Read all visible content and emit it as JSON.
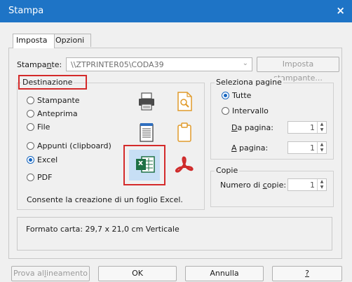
{
  "window": {
    "title": "Stampa",
    "close_symbol": "×"
  },
  "tabs": [
    {
      "label": "Imposta"
    },
    {
      "label": "Opzioni"
    }
  ],
  "printer": {
    "label_pre": "Stampa",
    "label_ul": "n",
    "label_post": "te:",
    "value": "\\\\ZTPRINTER05\\CODA39",
    "settings_button": "Imposta stampante..."
  },
  "destination": {
    "title": "Destinazione",
    "options": [
      {
        "label": "Stampante",
        "checked": false
      },
      {
        "label": "Anteprima",
        "checked": false
      },
      {
        "label": "File",
        "checked": false
      },
      {
        "label": "Appunti (clipboard)",
        "checked": false
      },
      {
        "label": "Excel",
        "checked": true
      },
      {
        "label": "PDF",
        "checked": false
      }
    ],
    "description": "Consente la creazione di un foglio Excel.",
    "icons": [
      "printer-icon",
      "preview-icon",
      "file-icon",
      "clipboard-icon",
      "excel-icon",
      "pdf-icon"
    ],
    "excel_icon_text": "x"
  },
  "pages": {
    "title": "Seleziona pagine",
    "all_label": "Tutte",
    "range_label": "Intervallo",
    "from_label_ul": "D",
    "from_label_rest": "a pagina:",
    "from_value": "1",
    "to_label_ul": "A",
    "to_label_rest": " pagina:",
    "to_value": "1"
  },
  "copies": {
    "title": "Copie",
    "label_pre": "Numero di ",
    "label_ul": "c",
    "label_post": "opie:",
    "value": "1"
  },
  "paper_format": "Formato carta: 29,7 x 21,0 cm Verticale",
  "buttons": {
    "align_pre": "Prova al",
    "align_ul": "l",
    "align_post": "ineamento",
    "ok": "OK",
    "cancel": "Annulla",
    "help": "?"
  },
  "colors": {
    "titlebar": "#1e74c6",
    "highlight": "#d42a2a",
    "excel_green": "#1e7145",
    "pdf_red": "#cf2b2b"
  }
}
